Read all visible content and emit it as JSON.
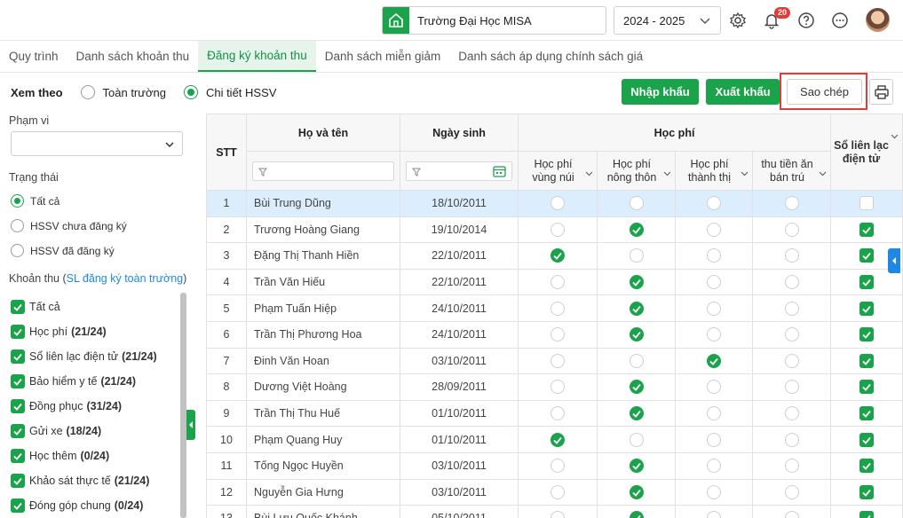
{
  "topbar": {
    "school_name": "Trường Đại Học MISA",
    "year": "2024 - 2025",
    "notification_count": "20"
  },
  "tabs": [
    {
      "label": "Quy trình",
      "active": false
    },
    {
      "label": "Danh sách khoản thu",
      "active": false
    },
    {
      "label": "Đăng ký khoản thu",
      "active": true
    },
    {
      "label": "Danh sách miễn giảm",
      "active": false
    },
    {
      "label": "Danh sách áp dụng chính sách giá",
      "active": false
    }
  ],
  "view": {
    "label": "Xem theo",
    "options": [
      "Toàn trường",
      "Chi tiết HSSV"
    ],
    "selected": "Chi tiết HSSV"
  },
  "buttons": {
    "import": "Nhập khẩu",
    "export": "Xuất khẩu",
    "copy": "Sao chép"
  },
  "filters": {
    "scope_label": "Phạm vi",
    "scope_value": "",
    "status_label": "Trạng thái",
    "status_options": [
      "Tất cả",
      "HSSV chưa đăng ký",
      "HSSV đã đăng ký"
    ],
    "status_selected": "Tất cả",
    "fees_label": "Khoản thu",
    "fees_link": "SL đăng ký toàn trường",
    "fees": [
      {
        "label": "Tất cả",
        "count": ""
      },
      {
        "label": "Học phí",
        "count": "(21/24)"
      },
      {
        "label": "Sổ liên lạc điện tử",
        "count": "(21/24)"
      },
      {
        "label": "Bảo hiểm y tế",
        "count": "(21/24)"
      },
      {
        "label": "Đồng phục",
        "count": "(31/24)"
      },
      {
        "label": "Gửi xe",
        "count": "(18/24)"
      },
      {
        "label": "Học thêm",
        "count": "(0/24)"
      },
      {
        "label": "Khảo sát thực tế",
        "count": "(21/24)"
      },
      {
        "label": "Đóng góp chung",
        "count": "(0/24)"
      }
    ]
  },
  "table": {
    "headers": {
      "stt": "STT",
      "name": "Họ và tên",
      "dob": "Ngày sinh",
      "tuition_group": "Học phí",
      "tuition_cols": [
        "Học phí\nvùng núi",
        "Học phí\nnông thôn",
        "Học phí\nthành thị",
        "thu tiền ăn\nbán trú"
      ],
      "contact_book": "Sổ liên lạc\nđiện tử"
    },
    "rows": [
      {
        "stt": "1",
        "name": "Bùi Trung Dũng",
        "dob": "18/10/2011",
        "fees": [
          0,
          0,
          0,
          0
        ],
        "contact": 0,
        "selected": true
      },
      {
        "stt": "2",
        "name": "Trương Hoàng Giang",
        "dob": "19/10/2014",
        "fees": [
          0,
          1,
          0,
          0
        ],
        "contact": 1
      },
      {
        "stt": "3",
        "name": "Đặng Thị Thanh Hiền",
        "dob": "22/10/2011",
        "fees": [
          1,
          0,
          0,
          0
        ],
        "contact": 1
      },
      {
        "stt": "4",
        "name": "Trần Văn Hiếu",
        "dob": "22/10/2011",
        "fees": [
          0,
          1,
          0,
          0
        ],
        "contact": 1
      },
      {
        "stt": "5",
        "name": "Phạm Tuấn Hiệp",
        "dob": "24/10/2011",
        "fees": [
          0,
          1,
          0,
          0
        ],
        "contact": 1
      },
      {
        "stt": "6",
        "name": "Trần Thị Phương Hoa",
        "dob": "24/10/2011",
        "fees": [
          0,
          1,
          0,
          0
        ],
        "contact": 1
      },
      {
        "stt": "7",
        "name": "Đinh Văn Hoan",
        "dob": "03/10/2011",
        "fees": [
          0,
          0,
          1,
          0
        ],
        "contact": 1
      },
      {
        "stt": "8",
        "name": "Dương Việt Hoàng",
        "dob": "28/09/2011",
        "fees": [
          0,
          1,
          0,
          0
        ],
        "contact": 1
      },
      {
        "stt": "9",
        "name": "Trần Thị Thu Huế",
        "dob": "01/10/2011",
        "fees": [
          0,
          1,
          0,
          0
        ],
        "contact": 1
      },
      {
        "stt": "10",
        "name": "Phạm Quang Huy",
        "dob": "01/10/2011",
        "fees": [
          1,
          0,
          0,
          0
        ],
        "contact": 1
      },
      {
        "stt": "11",
        "name": "Tống Ngọc Huyền",
        "dob": "03/10/2011",
        "fees": [
          0,
          1,
          0,
          0
        ],
        "contact": 1
      },
      {
        "stt": "12",
        "name": "Nguyễn Gia Hưng",
        "dob": "03/10/2011",
        "fees": [
          0,
          1,
          0,
          0
        ],
        "contact": 1
      },
      {
        "stt": "13",
        "name": "Bùi Lưu Quốc Khánh",
        "dob": "05/10/2011",
        "fees": [
          0,
          1,
          0,
          0
        ],
        "contact": 1
      }
    ]
  },
  "colors": {
    "accent": "#1aa34a",
    "highlight_box": "#e23b3b",
    "selected_row": "#dceefe"
  }
}
